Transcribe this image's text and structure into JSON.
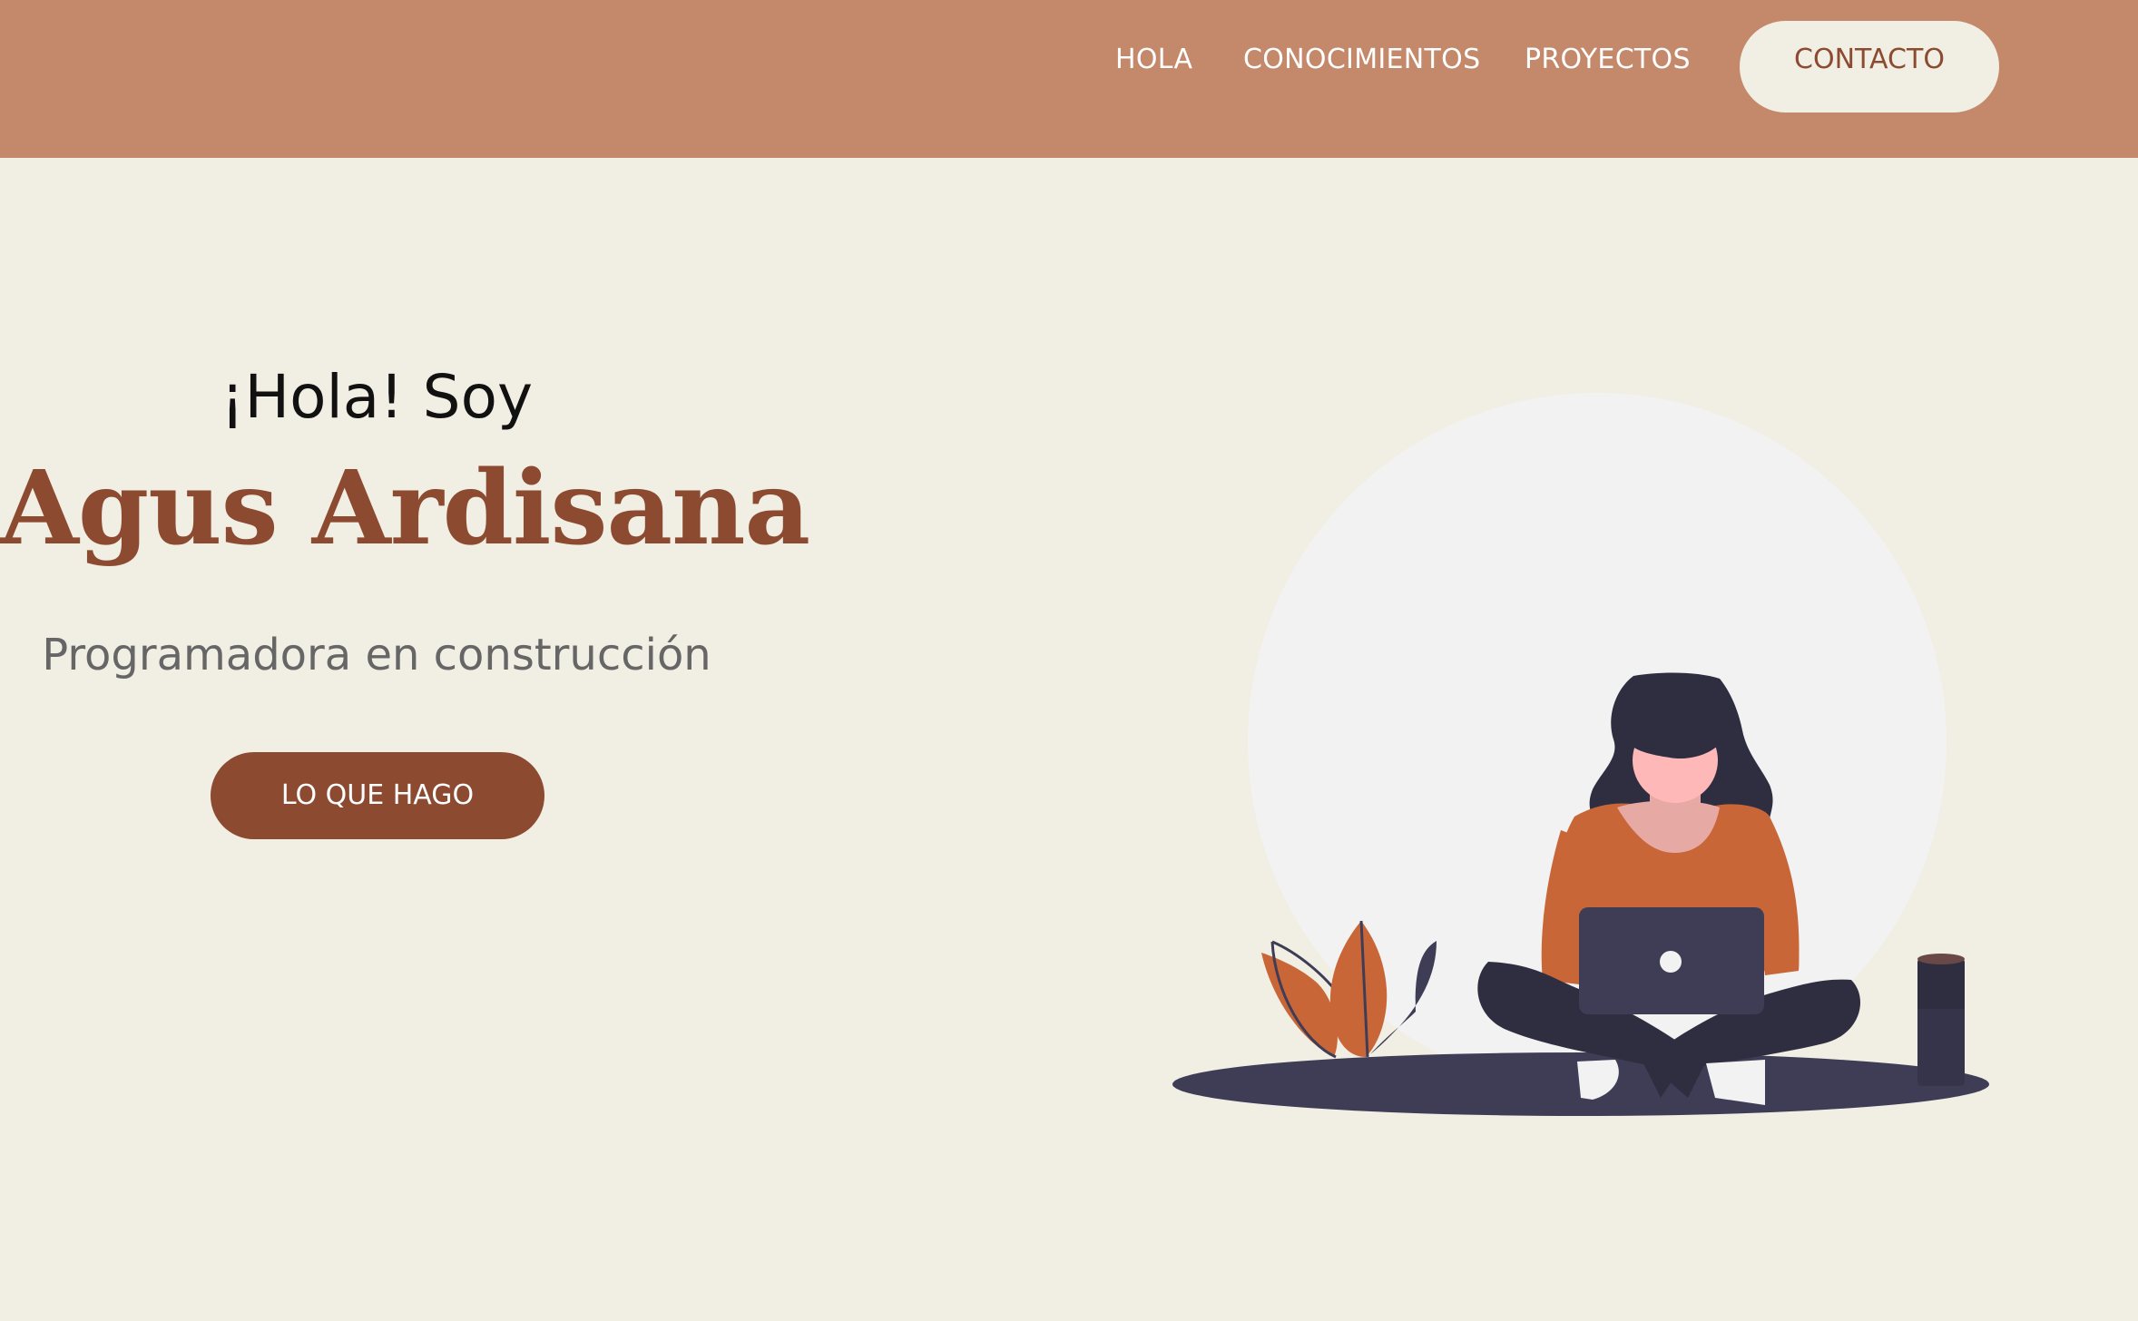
{
  "nav": {
    "links": [
      {
        "label": "HOLA"
      },
      {
        "label": "CONOCIMIENTOS"
      },
      {
        "label": "PROYECTOS"
      }
    ],
    "contact_label": "CONTACTO"
  },
  "hero": {
    "greeting": "¡Hola! Soy",
    "name": "Agus Ardisana",
    "subtitle": "Programadora en construcción",
    "button_label": "LO QUE HAGO"
  },
  "illustration": {
    "icon": "woman-with-laptop-illustration"
  },
  "colors": {
    "header_bg": "#c4896b",
    "page_bg": "#f1eee3",
    "accent": "#8c4a31",
    "subtitle_text": "#666666"
  }
}
